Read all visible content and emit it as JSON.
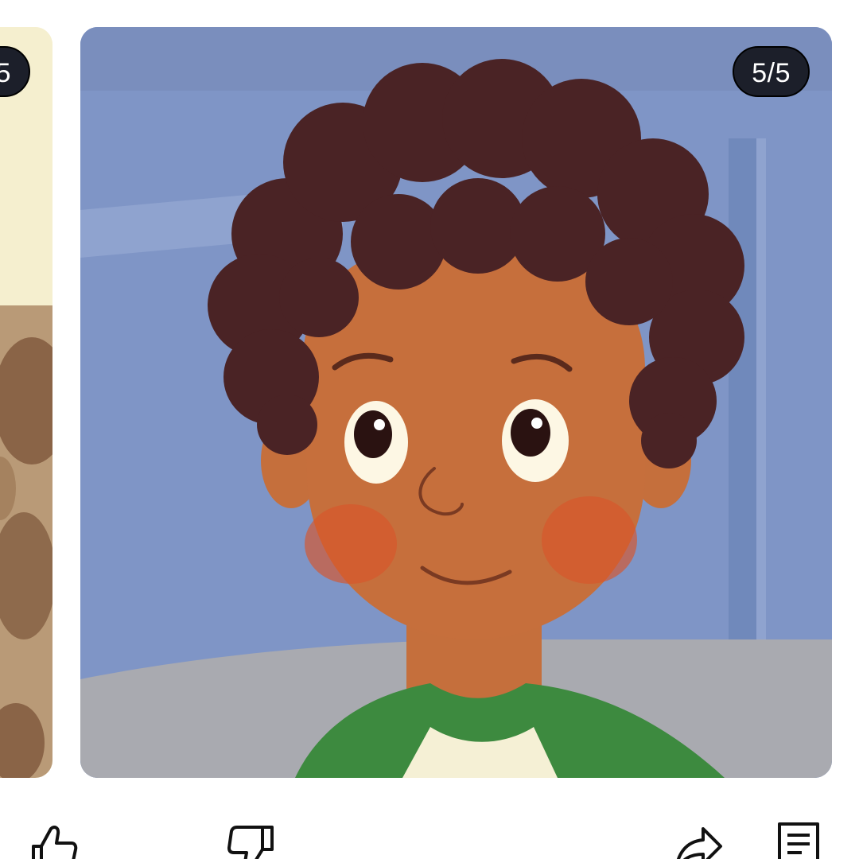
{
  "carousel": {
    "previous_counter": "5",
    "current_counter": "5/5"
  },
  "actions": {
    "like_icon": "thumbs-up-icon",
    "dislike_icon": "thumbs-down-icon",
    "share_icon": "share-icon",
    "comments_icon": "comments-icon"
  },
  "colors": {
    "counter_bg": "#1c1f2a",
    "counter_text": "#ffffff",
    "current_slide_bg": "#7f95c6",
    "previous_slide_bg": "#f5efcf"
  }
}
